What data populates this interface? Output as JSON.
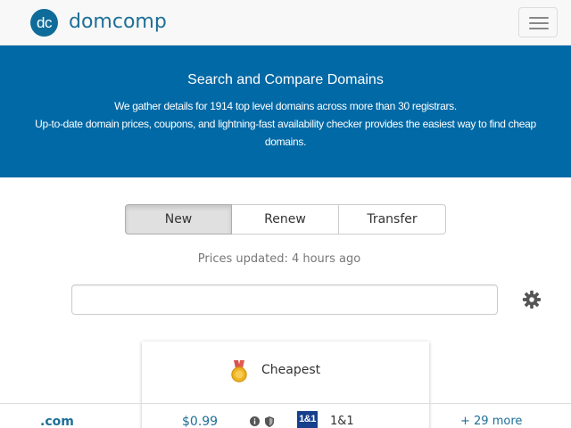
{
  "header": {
    "logo_badge": "dc",
    "logo_text": "domcomp",
    "menu_icon": "hamburger-icon"
  },
  "hero": {
    "title": "Search and Compare Domains",
    "line1": "We gather details for 1914 top level domains across more than 30 registrars.",
    "line2": "Up-to-date domain prices, coupons, and lightning-fast availability checker provides the easiest way to find cheap",
    "line3": "domains."
  },
  "tabs": [
    {
      "label": "New",
      "active": true
    },
    {
      "label": "Renew",
      "active": false
    },
    {
      "label": "Transfer",
      "active": false
    }
  ],
  "status": {
    "updated": "Prices updated: 4 hours ago"
  },
  "search": {
    "value": "",
    "placeholder": ""
  },
  "settings_icon": "gear-icon",
  "card": {
    "icon": "medal-icon",
    "label": "Cheapest"
  },
  "results": [
    {
      "tld": ".com",
      "price": "$0.99",
      "icons": [
        "info-icon",
        "shield-icon"
      ],
      "registrar_logo": "1&1",
      "registrar": "1&1",
      "more": "+ 29 more"
    }
  ],
  "colors": {
    "brand": "#0f6b9a",
    "hero_bg": "#0069a6",
    "link": "#1e6f98",
    "registrar_logo": "#163f8c"
  }
}
